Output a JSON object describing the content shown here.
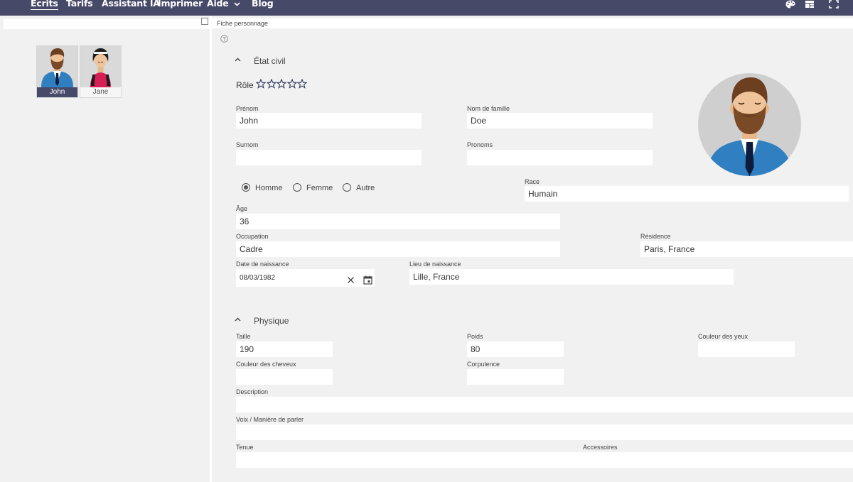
{
  "nav": {
    "items": [
      {
        "label": "Ecrits"
      },
      {
        "label": "Tarifs"
      },
      {
        "label": "Assistant IA"
      },
      {
        "label": "Imprimer"
      },
      {
        "label": "Aide"
      },
      {
        "label": "Blog"
      }
    ],
    "active": "Ecrits",
    "icons": [
      "palette-icon",
      "layout-icon",
      "fullscreen-icon"
    ]
  },
  "characters": [
    {
      "name": "John",
      "selected": true
    },
    {
      "name": "Jane",
      "selected": false
    }
  ],
  "tab": {
    "label": "Fiche personnage"
  },
  "sections": {
    "civil": "État civil",
    "physical": "Physique"
  },
  "role": {
    "label": "Rôle",
    "rating": 0,
    "max": 5
  },
  "fields": {
    "prenom": {
      "label": "Prénom",
      "value": "John"
    },
    "nom": {
      "label": "Nom de famille",
      "value": "Doe"
    },
    "surnom": {
      "label": "Surnom",
      "value": ""
    },
    "pronoms": {
      "label": "Pronoms",
      "value": ""
    },
    "race": {
      "label": "Race",
      "value": "Humain"
    },
    "age": {
      "label": "Âge",
      "value": "36"
    },
    "occupation": {
      "label": "Occupation",
      "value": "Cadre"
    },
    "residence": {
      "label": "Résidence",
      "value": "Paris, France"
    },
    "date_naissance": {
      "label": "Date de naissance",
      "value": "08/03/1982"
    },
    "lieu_naissance": {
      "label": "Lieu de naissance",
      "value": "Lille, France"
    },
    "taille": {
      "label": "Taille",
      "value": "190"
    },
    "poids": {
      "label": "Poids",
      "value": "80"
    },
    "yeux": {
      "label": "Couleur des yeux",
      "value": ""
    },
    "cheveux": {
      "label": "Couleur des cheveux",
      "value": ""
    },
    "corpulence": {
      "label": "Corpulence",
      "value": ""
    },
    "description": {
      "label": "Description",
      "value": ""
    },
    "voix": {
      "label": "Voix / Manière de parler",
      "value": ""
    },
    "tenue": {
      "label": "Tenue",
      "value": ""
    },
    "accessoires": {
      "label": "Accessoires",
      "value": ""
    }
  },
  "gender": {
    "options": [
      "Homme",
      "Femme",
      "Autre"
    ],
    "selected": "Homme"
  },
  "colors": {
    "topbar": "#474969",
    "selected_card": "#474969",
    "suit_blue": "#2f7fc1",
    "beard": "#7a4a26"
  }
}
